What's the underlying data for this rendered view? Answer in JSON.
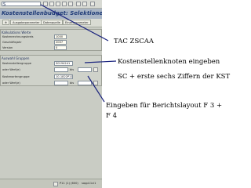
{
  "sap": {
    "command_field": "S",
    "title": "Kostenstellenbudget: Selektionen",
    "app_toolbar": [
      "Ausgabeparameter",
      "Datenquelle",
      "Einzelparameter"
    ],
    "group1": {
      "title": "Kalkulations Werte",
      "rows": [
        {
          "label": "Kostenrechnungskreis",
          "value": "1000"
        },
        {
          "label": "Geschäftsjahr",
          "value": "2007"
        },
        {
          "label": "Version",
          "value": "0"
        }
      ]
    },
    "group2": {
      "title": "Auswahl Gruppen",
      "rows": [
        {
          "label": "Kostenstellengruppe",
          "value": "S0194241",
          "sub_label": ""
        },
        {
          "label": "oder Wert(e)",
          "value": "",
          "sub_label": "bis"
        },
        {
          "label": "Kostenartengruppe",
          "value": "10-1822P11",
          "sub_label": ""
        },
        {
          "label": "oder Wert(e)",
          "value": "",
          "sub_label": "bis"
        }
      ]
    },
    "statusbar": {
      "system": "P11 (1) (600)",
      "host": "sapp11ci1"
    }
  },
  "annotations": {
    "tac": "TAC ZSCAA",
    "kst_node": "Kostenstellenknoten eingeben",
    "kst_digits": "SC + erste sechs Ziffern der KST",
    "layout_line1": "Eingeben für Berichtslayout F 3 +",
    "layout_line2": "F 4"
  },
  "colors": {
    "sap_background": "#c9ccc4",
    "title_bar": "#a8b4c4",
    "title_text": "#203c78",
    "annotation_line": "#1a237e"
  }
}
